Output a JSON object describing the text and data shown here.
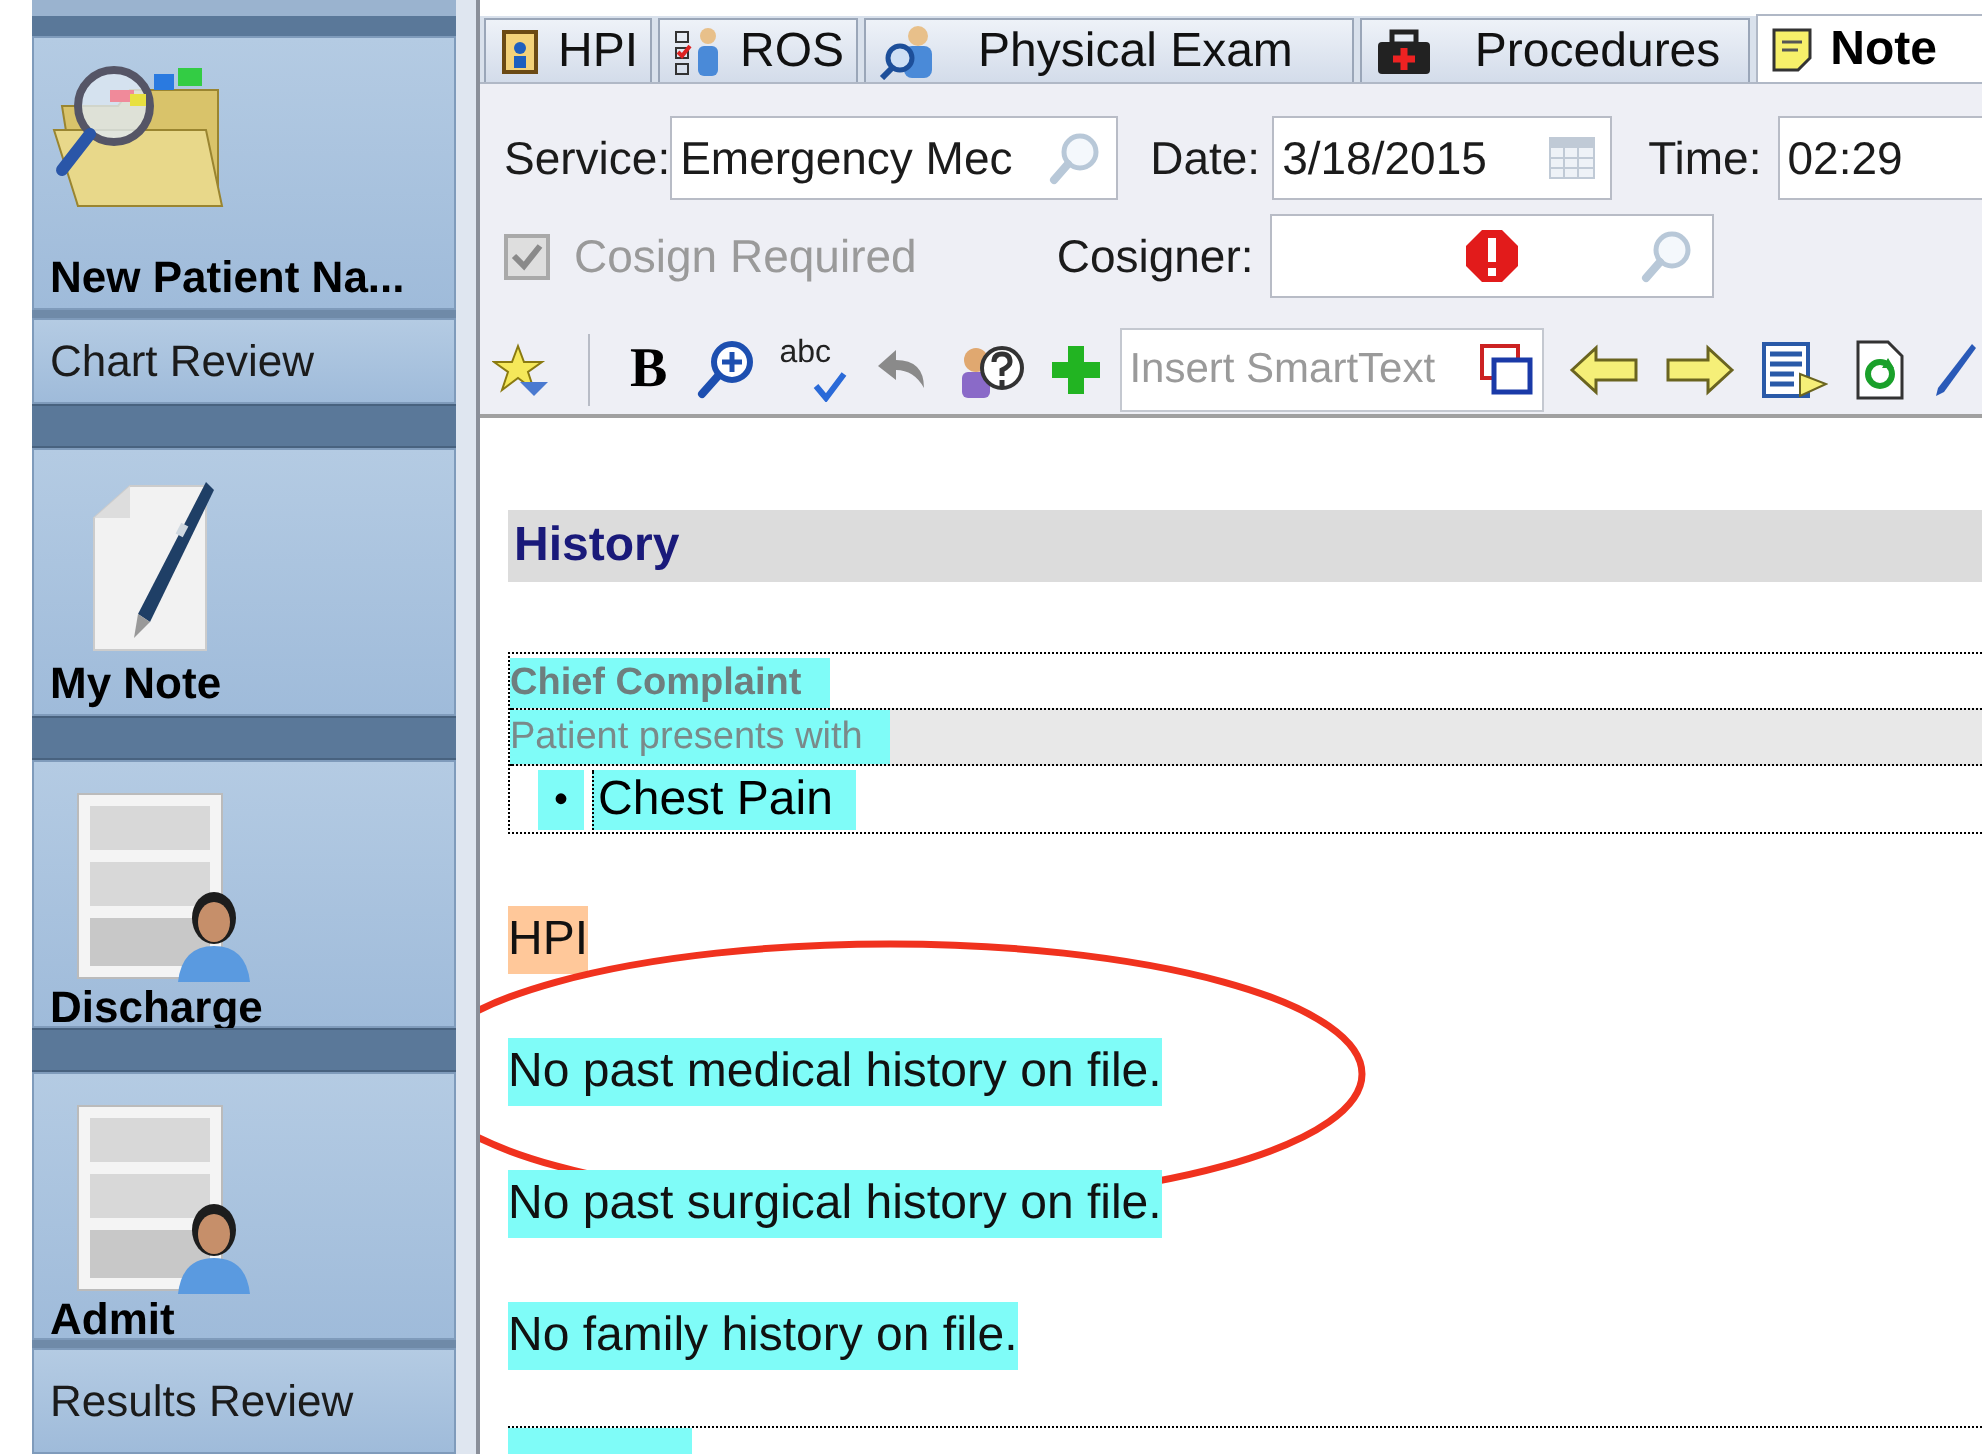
{
  "sidebar": {
    "items": [
      {
        "kind": "search",
        "label": "New Patient Na...",
        "group_start": true
      },
      {
        "kind": "plain",
        "label": "Chart Review",
        "group_start": false
      },
      {
        "kind": "note",
        "label": "My Note",
        "group_start": true
      },
      {
        "kind": "form",
        "label": "Discharge",
        "group_start": true
      },
      {
        "kind": "form",
        "label": "Admit",
        "group_start": true
      },
      {
        "kind": "plain",
        "label": "Results Review",
        "group_start": false
      }
    ]
  },
  "tabs": [
    {
      "label": "HPI",
      "selected": false
    },
    {
      "label": "ROS",
      "selected": false
    },
    {
      "label": "Physical Exam",
      "selected": false
    },
    {
      "label": "Procedures",
      "selected": false
    },
    {
      "label": "Note",
      "selected": true
    }
  ],
  "form": {
    "service": {
      "label": "Service:",
      "value": "Emergency Mec"
    },
    "date": {
      "label": "Date:",
      "value": "3/18/2015"
    },
    "time": {
      "label": "Time:",
      "value": "02:29"
    },
    "cosign_required": {
      "label": "Cosign Required",
      "checked": true,
      "disabled": true
    },
    "cosigner": {
      "label": "Cosigner:",
      "error": true
    }
  },
  "toolbar": [
    {
      "kind": "star"
    },
    {
      "kind": "bold",
      "label": "B"
    },
    {
      "kind": "zoom"
    },
    {
      "kind": "spell",
      "label": "abc"
    },
    {
      "kind": "undo",
      "disabled": true
    },
    {
      "kind": "help"
    },
    {
      "kind": "add"
    },
    {
      "kind": "smarttext",
      "placeholder": "Insert SmartText"
    },
    {
      "kind": "back"
    },
    {
      "kind": "forward"
    },
    {
      "kind": "list"
    },
    {
      "kind": "refresh"
    },
    {
      "kind": "pen"
    }
  ],
  "note": {
    "heading": "History",
    "chief_complaint": {
      "title": "Chief Complaint",
      "intro": "Patient presents with",
      "items": [
        {
          "bullet": "•",
          "text": "Chest Pain"
        }
      ]
    },
    "paragraphs": [
      {
        "text": "HPI",
        "color": "#ffc89a",
        "circled": false
      },
      {
        "text": "No past medical history on file.",
        "color": "#7ffcf8",
        "circled": true
      },
      {
        "text": "No past surgical history on file.",
        "color": "#7ffcf8",
        "circled": false
      },
      {
        "text": "No family history on file.",
        "color": "#7ffcf8",
        "circled": false
      }
    ]
  }
}
